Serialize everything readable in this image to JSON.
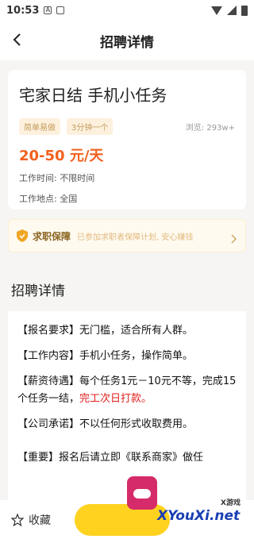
{
  "status_bar": {
    "time": "10:53",
    "app_badge": "A"
  },
  "nav": {
    "title": "招聘详情"
  },
  "job": {
    "title": "宅家日结 手机小任务",
    "tags": [
      "简单易做",
      "3分钟一个"
    ],
    "views": "浏览: 293w+",
    "salary": "20-50 元/天",
    "work_time": "工作时间: 不限时间",
    "work_place": "工作地点: 全国"
  },
  "guarantee": {
    "label": "求职保障",
    "desc": "已参加求职者保障计划, 安心赚钱"
  },
  "section_title": "招聘详情",
  "detail": {
    "req": "【报名要求】无门槛，适合所有人群。",
    "content": "【工作内容】手机小任务，操作简单。",
    "pay_prefix": "【薪资待遇】每个任务1元－10元不等，完成15个任务一结，",
    "pay_red": "完工次日打款。",
    "promise": "【公司承诺】不以任何形式收取费用。",
    "important": "【重要】报名后请立即《联系商家》做任"
  },
  "bottom": {
    "favorite_label": "收藏"
  },
  "watermark": {
    "top": "X游戏",
    "main": "XYouXi.net"
  },
  "colors": {
    "accent": "#f2601d",
    "button": "#ffd21f",
    "tag_bg": "#fdf1de"
  }
}
